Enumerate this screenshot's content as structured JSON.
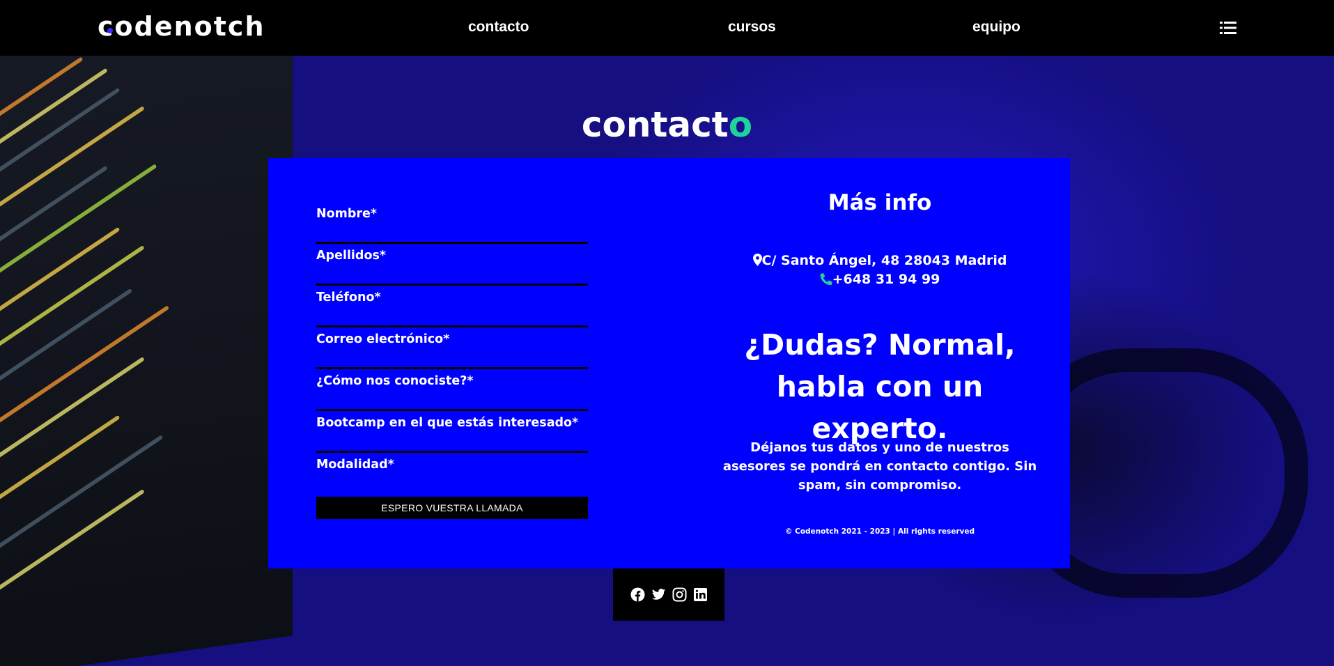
{
  "brand": {
    "logo_text": "codenotch"
  },
  "nav": {
    "items": [
      {
        "label": "contacto"
      },
      {
        "label": "cursos"
      },
      {
        "label": "equipo"
      }
    ],
    "menu_icon": "list-icon"
  },
  "page": {
    "title_main": "contact",
    "title_accent": "o"
  },
  "form": {
    "fields": [
      {
        "label": "Nombre*"
      },
      {
        "label": "Apellidos*"
      },
      {
        "label": "Teléfono*"
      },
      {
        "label": "Correo electrónico*"
      },
      {
        "label": "¿Cómo nos conociste?*"
      },
      {
        "label": "Bootcamp en el que estás interesado*"
      },
      {
        "label": "Modalidad*"
      }
    ],
    "submit_label": "ESPERO VUESTRA LLAMADA"
  },
  "info": {
    "title": "Más info",
    "address": "C/ Santo Ángel, 48 28043 Madrid",
    "phone": "+648 31 94 99",
    "headline": "¿Dudas? Normal, habla con un experto.",
    "blurb": "Déjanos tus datos y uno de nuestros asesores se pondrá en contacto contigo. Sin spam, sin compromiso.",
    "copyright": "© Codenotch 2021 - 2023 | All rights reserved"
  },
  "social": [
    "facebook-icon",
    "twitter-icon",
    "instagram-icon",
    "linkedin-icon"
  ],
  "colors": {
    "panel": "#0000ff",
    "accent": "#1fd39a",
    "header": "#000000"
  }
}
